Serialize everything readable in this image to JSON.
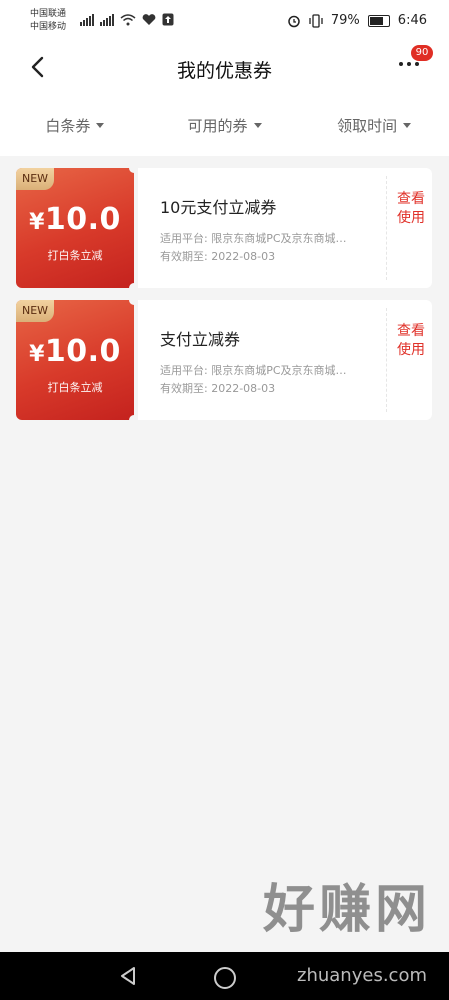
{
  "status_bar": {
    "carrier1": "中国联通",
    "carrier2": "中国移动",
    "battery_percent": "79%",
    "battery_level": 0.79,
    "time": "6:46",
    "icons": [
      "signal-5g-icon",
      "signal-4g-icon",
      "wifi-icon",
      "heart-icon",
      "upload-icon",
      "alarm-icon",
      "vibrate-icon",
      "battery-icon"
    ]
  },
  "header": {
    "back_icon": "chevron-left-icon",
    "title": "我的优惠券",
    "more_icon": "more-dots-icon",
    "badge": "90"
  },
  "filters": [
    {
      "label": "白条券"
    },
    {
      "label": "可用的券"
    },
    {
      "label": "领取时间"
    }
  ],
  "coupons": [
    {
      "tag": "NEW",
      "currency": "¥",
      "amount": "10.0",
      "type": "打白条立减",
      "name": "10元支付立减券",
      "platform": "适用平台: 限京东商城PC及京东商城APP",
      "expiry": "有效期至: 2022-08-03",
      "action": "查看使用"
    },
    {
      "tag": "NEW",
      "currency": "¥",
      "amount": "10.0",
      "type": "打白条立减",
      "name": "支付立减券",
      "platform": "适用平台: 限京东商城PC及京东商城APP",
      "expiry": "有效期至: 2022-08-03",
      "action": "查看使用"
    }
  ],
  "watermark": {
    "text": "好赚网",
    "url": "zhuanyes.com"
  },
  "colors": {
    "accent": "#e0322a",
    "coupon_gradient_start": "#e86646",
    "coupon_gradient_end": "#c4221e",
    "new_tag": "#dab078"
  }
}
